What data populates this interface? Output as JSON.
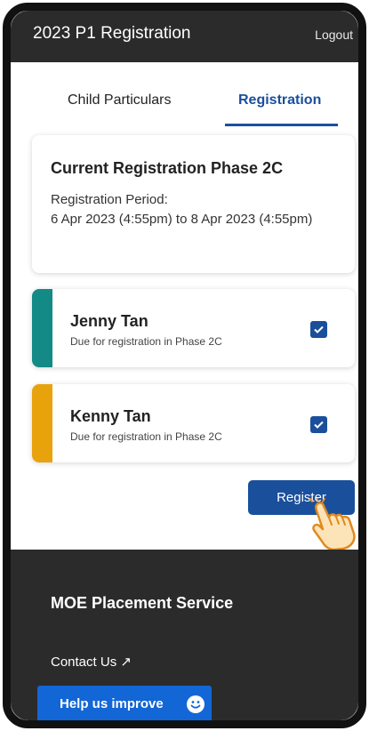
{
  "appbar": {
    "title": "2023 P1 Registration",
    "logout_label": "Logout"
  },
  "tabs": [
    {
      "label": "Child Particulars",
      "active": false
    },
    {
      "label": "Registration",
      "active": true
    }
  ],
  "phase_card": {
    "title": "Current Registration Phase 2C",
    "period_label": "Registration Period:",
    "period_dates": "6 Apr 2023 (4:55pm) to 8 Apr 2023 (4:55pm)"
  },
  "children": [
    {
      "name": "Jenny Tan",
      "status": "Due for registration in Phase 2C",
      "accent": "#138a86",
      "checked": true
    },
    {
      "name": "Kenny Tan",
      "status": "Due for registration in Phase 2C",
      "accent": "#e8a20c",
      "checked": true
    }
  ],
  "register_button": {
    "label": "Register"
  },
  "footer": {
    "service_title": "MOE Placement Service",
    "contact_label": "Contact Us ↗",
    "second_link": "↗"
  },
  "help_button": {
    "label": "Help us improve"
  },
  "colors": {
    "primary": "#1a4f9c",
    "dark": "#2b2b2b",
    "help": "#1266d6"
  }
}
